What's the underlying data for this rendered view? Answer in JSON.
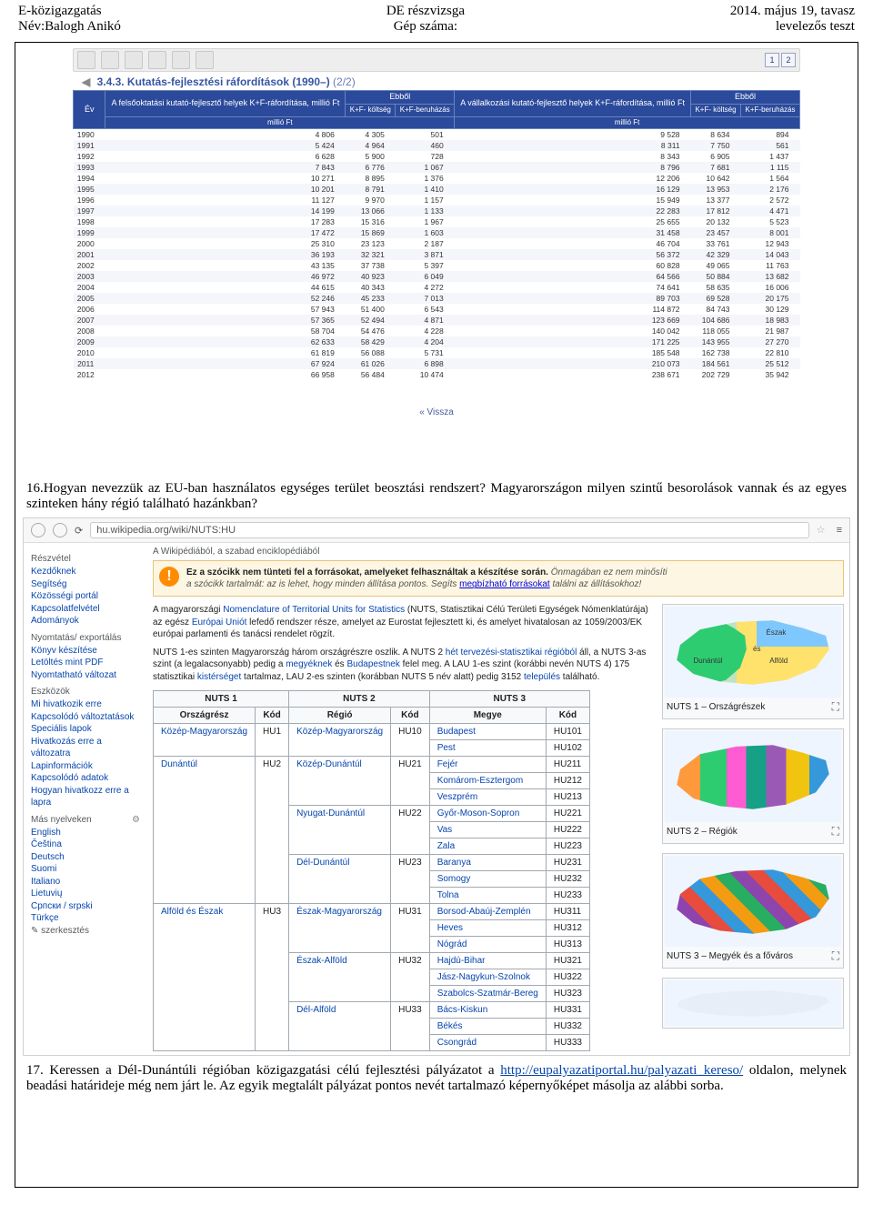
{
  "header": {
    "topLeft": "E-közigazgatás",
    "topCenter": "DE részvizsga",
    "topRight": "2014. május 19, tavasz",
    "botLeft": "Név:Balogh Anikó",
    "botCenter": "Gép száma:",
    "botRight": "levelezős teszt"
  },
  "shot1": {
    "titlePrefix": "3.4.3. Kutatás-fejlesztési ráfordítások (1990–)",
    "titlePage": "(2/2)",
    "pager": [
      "1",
      "2"
    ],
    "backText": "« Vissza",
    "head": {
      "ev": "Év",
      "grp1": "A felsőoktatási kutató-fejlesztő helyek K+F-ráfordítása, millió Ft",
      "ebbol": "Ebből",
      "kolt": "K+F- költség",
      "beru": "K+F-beruházás",
      "grp2": "A vállalkozási kutató-fejlesztő helyek K+F-ráfordítása, millió Ft",
      "millio": "millió Ft"
    },
    "rows": [
      [
        "1990",
        "4 806",
        "4 305",
        "501",
        "9 528",
        "8 634",
        "894"
      ],
      [
        "1991",
        "5 424",
        "4 964",
        "460",
        "8 311",
        "7 750",
        "561"
      ],
      [
        "1992",
        "6 628",
        "5 900",
        "728",
        "8 343",
        "6 905",
        "1 437"
      ],
      [
        "1993",
        "7 843",
        "6 776",
        "1 067",
        "8 796",
        "7 681",
        "1 115"
      ],
      [
        "1994",
        "10 271",
        "8 895",
        "1 376",
        "12 206",
        "10 642",
        "1 564"
      ],
      [
        "1995",
        "10 201",
        "8 791",
        "1 410",
        "16 129",
        "13 953",
        "2 176"
      ],
      [
        "1996",
        "11 127",
        "9 970",
        "1 157",
        "15 949",
        "13 377",
        "2 572"
      ],
      [
        "1997",
        "14 199",
        "13 066",
        "1 133",
        "22 283",
        "17 812",
        "4 471"
      ],
      [
        "1998",
        "17 283",
        "15 316",
        "1 967",
        "25 655",
        "20 132",
        "5 523"
      ],
      [
        "1999",
        "17 472",
        "15 869",
        "1 603",
        "31 458",
        "23 457",
        "8 001"
      ],
      [
        "2000",
        "25 310",
        "23 123",
        "2 187",
        "46 704",
        "33 761",
        "12 943"
      ],
      [
        "2001",
        "36 193",
        "32 321",
        "3 871",
        "56 372",
        "42 329",
        "14 043"
      ],
      [
        "2002",
        "43 135",
        "37 738",
        "5 397",
        "60 828",
        "49 065",
        "11 763"
      ],
      [
        "2003",
        "46 972",
        "40 923",
        "6 049",
        "64 566",
        "50 884",
        "13 682"
      ],
      [
        "2004",
        "44 615",
        "40 343",
        "4 272",
        "74 641",
        "58 635",
        "16 006"
      ],
      [
        "2005",
        "52 246",
        "45 233",
        "7 013",
        "89 703",
        "69 528",
        "20 175"
      ],
      [
        "2006",
        "57 943",
        "51 400",
        "6 543",
        "114 872",
        "84 743",
        "30 129"
      ],
      [
        "2007",
        "57 365",
        "52 494",
        "4 871",
        "123 669",
        "104 686",
        "18 983"
      ],
      [
        "2008",
        "58 704",
        "54 476",
        "4 228",
        "140 042",
        "118 055",
        "21 987"
      ],
      [
        "2009",
        "62 633",
        "58 429",
        "4 204",
        "171 225",
        "143 955",
        "27 270"
      ],
      [
        "2010",
        "61 819",
        "56 088",
        "5 731",
        "185 548",
        "162 738",
        "22 810"
      ],
      [
        "2011",
        "67 924",
        "61 026",
        "6 898",
        "210 073",
        "184 561",
        "25 512"
      ],
      [
        "2012",
        "66 958",
        "56 484",
        "10 474",
        "238 671",
        "202 729",
        "35 942"
      ]
    ]
  },
  "q16": {
    "text": "16.Hogyan nevezzük az EU-ban használatos egységes terület beosztási rendszert? Magyarországon milyen szintű besorolások vannak és az egyes szinteken hány régió található hazánkban?"
  },
  "shot2": {
    "url": "hu.wikipedia.org/wiki/NUTS:HU",
    "subtitle": "A Wikipédiából, a szabad enciklopédiából",
    "warning": {
      "line1a": "Ez a szócikk ",
      "line1b": "nem tünteti fel a forrásokat",
      "line1c": ", amelyeket felhasználtak a készítése során.",
      "line1d": " Önmagában ez nem minősíti",
      "line2a": "a szócikk tartalmát: az is lehet, hogy minden állítása pontos. Segíts ",
      "line2link": "megbízható forrásokat",
      "line2b": " találni az állításokhoz!"
    },
    "para1": {
      "t1": "A magyarországi ",
      "l1": "Nomenclature of Territorial Units for Statistics",
      "t2": " (NUTS, Statisztikai Célú Területi Egységek Nómenklatúrája) az egész ",
      "l2": "Európai Uniót",
      "t3": " lefedő rendszer része, amelyet az Eurostat fejlesztett ki, és amelyet hivatalosan az 1059/2003/EK európai parlamenti és tanácsi rendelet rögzít."
    },
    "para2": {
      "t1": "NUTS 1-es szinten Magyarország három országrészre oszlik. A NUTS 2 ",
      "l1": "hét tervezési-statisztikai régióból",
      "t2": " áll, a NUTS 3-as szint (a legalacsonyabb) pedig a ",
      "l2": "megyéknek",
      "t3": " és ",
      "l3": "Budapestnek",
      "t4": " felel meg. A LAU 1-es szint (korábbi nevén NUTS 4) 175 statisztikai ",
      "l4": "kistérséget",
      "t5": " tartalmaz, LAU 2-es szinten (korábban NUTS 5 név alatt) pedig 3152 ",
      "l5": "település",
      "t6": " található."
    },
    "nutsHead": {
      "n1": "NUTS 1",
      "n2": "NUTS 2",
      "n3": "NUTS 3",
      "orszag": "Országrész",
      "kod": "Kód",
      "regio": "Régió",
      "megye": "Megye"
    },
    "mapCaptions": {
      "m1": "NUTS 1 – Országrészek",
      "m2": "NUTS 2 – Régiók",
      "m3": "NUTS 3 – Megyék és a főváros"
    },
    "mapLabels": {
      "dun": "Dunántúl",
      "alf": "Alföld",
      "esz": "Észak",
      "es": "és"
    },
    "sidebar": {
      "sec1": "Részvétel",
      "s1": [
        "Kezdőknek",
        "Segítség",
        "Közösségi portál",
        "Kapcsolatfelvétel",
        "Adományok"
      ],
      "sec2": "Nyomtatás/ exportálás",
      "s2": [
        "Könyv készítése",
        "Letöltés mint PDF",
        "Nyomtatható változat"
      ],
      "sec3": "Eszközök",
      "s3": [
        "Mi hivatkozik erre",
        "Kapcsolódó változtatások",
        "Speciális lapok",
        "Hivatkozás erre a változatra",
        "Lapinformációk",
        "Kapcsolódó adatok",
        "Hogyan hivatkozz erre a lapra"
      ],
      "sec4": "Más nyelveken",
      "s4": [
        "English",
        "Čeština",
        "Deutsch",
        "Suomi",
        "Italiano",
        "Lietuvių",
        "Српски / srpski",
        "Türkçe"
      ],
      "edit": "szerkesztés"
    },
    "nutsRows": [
      {
        "n1": "Közép-Magyarország",
        "k1": "HU1",
        "n2": "Közép-Magyarország",
        "k2": "HU10",
        "rows": [
          [
            "Budapest",
            "HU101"
          ],
          [
            "Pest",
            "HU102"
          ]
        ]
      },
      {
        "n1": "Dunántúl",
        "k1": "HU2",
        "sub": [
          {
            "n2": "Közép-Dunántúl",
            "k2": "HU21",
            "rows": [
              [
                "Fejér",
                "HU211"
              ],
              [
                "Komárom-Esztergom",
                "HU212"
              ],
              [
                "Veszprém",
                "HU213"
              ]
            ]
          },
          {
            "n2": "Nyugat-Dunántúl",
            "k2": "HU22",
            "rows": [
              [
                "Győr-Moson-Sopron",
                "HU221"
              ],
              [
                "Vas",
                "HU222"
              ],
              [
                "Zala",
                "HU223"
              ]
            ]
          },
          {
            "n2": "Dél-Dunántúl",
            "k2": "HU23",
            "rows": [
              [
                "Baranya",
                "HU231"
              ],
              [
                "Somogy",
                "HU232"
              ],
              [
                "Tolna",
                "HU233"
              ]
            ]
          }
        ]
      },
      {
        "n1": "Alföld és Észak",
        "k1": "HU3",
        "sub": [
          {
            "n2": "Észak-Magyarország",
            "k2": "HU31",
            "rows": [
              [
                "Borsod-Abaúj-Zemplén",
                "HU311"
              ],
              [
                "Heves",
                "HU312"
              ],
              [
                "Nógrád",
                "HU313"
              ]
            ]
          },
          {
            "n2": "Észak-Alföld",
            "k2": "HU32",
            "rows": [
              [
                "Hajdú-Bihar",
                "HU321"
              ],
              [
                "Jász-Nagykun-Szolnok",
                "HU322"
              ],
              [
                "Szabolcs-Szatmár-Bereg",
                "HU323"
              ]
            ]
          },
          {
            "n2": "Dél-Alföld",
            "k2": "HU33",
            "rows": [
              [
                "Bács-Kiskun",
                "HU331"
              ],
              [
                "Békés",
                "HU332"
              ],
              [
                "Csongrád",
                "HU333"
              ]
            ]
          }
        ]
      }
    ]
  },
  "q17": {
    "t1": "17. Keressen a Dél-Dunántúli régióban közigazgatási célú fejlesztési pályázatot a ",
    "link": "http://eupalyazatiportal.hu/palyazati_kereso/",
    "t2": " oldalon, melynek beadási határideje még nem járt le. Az egyik megtalált pályázat pontos nevét tartalmazó képernyőképet másolja az alábbi sorba."
  }
}
